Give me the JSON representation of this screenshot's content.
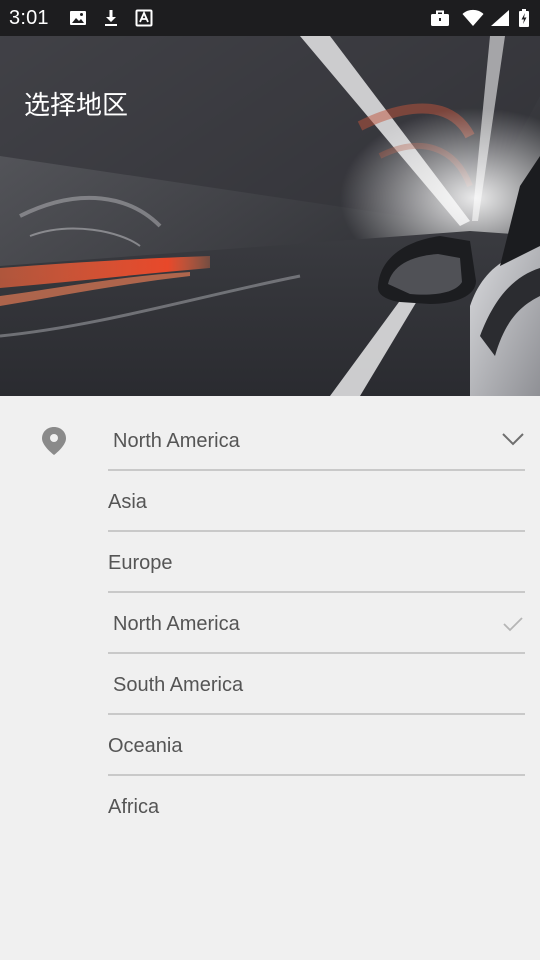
{
  "status_bar": {
    "time": "3:01",
    "icons": [
      "image-icon",
      "download-icon",
      "text-a-icon",
      "briefcase-icon",
      "wifi-icon",
      "cellular-signal-icon",
      "battery-charging-icon"
    ]
  },
  "header": {
    "title": "选择地区"
  },
  "region_selector": {
    "location_icon": "location-pin-icon",
    "selected": "North America",
    "options": [
      "Asia",
      "Europe",
      "North America",
      "South America",
      "Oceania",
      "Africa"
    ],
    "checked_option": "North America"
  },
  "colors": {
    "status_bar_bg": "#1d1d1f",
    "page_bg": "#f0f0f0",
    "text": "#555555",
    "divider": "#c9c9c9",
    "icon_gray": "#8a8a8a",
    "check_gray": "#b5b5b5"
  }
}
